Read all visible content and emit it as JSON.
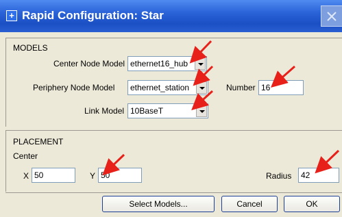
{
  "window": {
    "title": "Rapid Configuration: Star"
  },
  "models": {
    "section_label": "MODELS",
    "center_node_label": "Center Node Model",
    "center_node_value": "ethernet16_hub",
    "periphery_node_label": "Periphery Node Model",
    "periphery_node_value": "ethernet_station",
    "number_label": "Number",
    "number_value": "16",
    "link_model_label": "Link Model",
    "link_model_value": "10BaseT"
  },
  "placement": {
    "section_label": "PLACEMENT",
    "center_label": "Center",
    "x_label": "X",
    "x_value": "50",
    "y_label": "Y",
    "y_value": "50",
    "radius_label": "Radius",
    "radius_value": "42"
  },
  "buttons": {
    "select_models": "Select Models...",
    "cancel": "Cancel",
    "ok": "OK"
  },
  "colors": {
    "titlebar": "#2a62d8",
    "annotation_arrow": "#e8201a",
    "dialog_bg": "#ece9d8"
  }
}
